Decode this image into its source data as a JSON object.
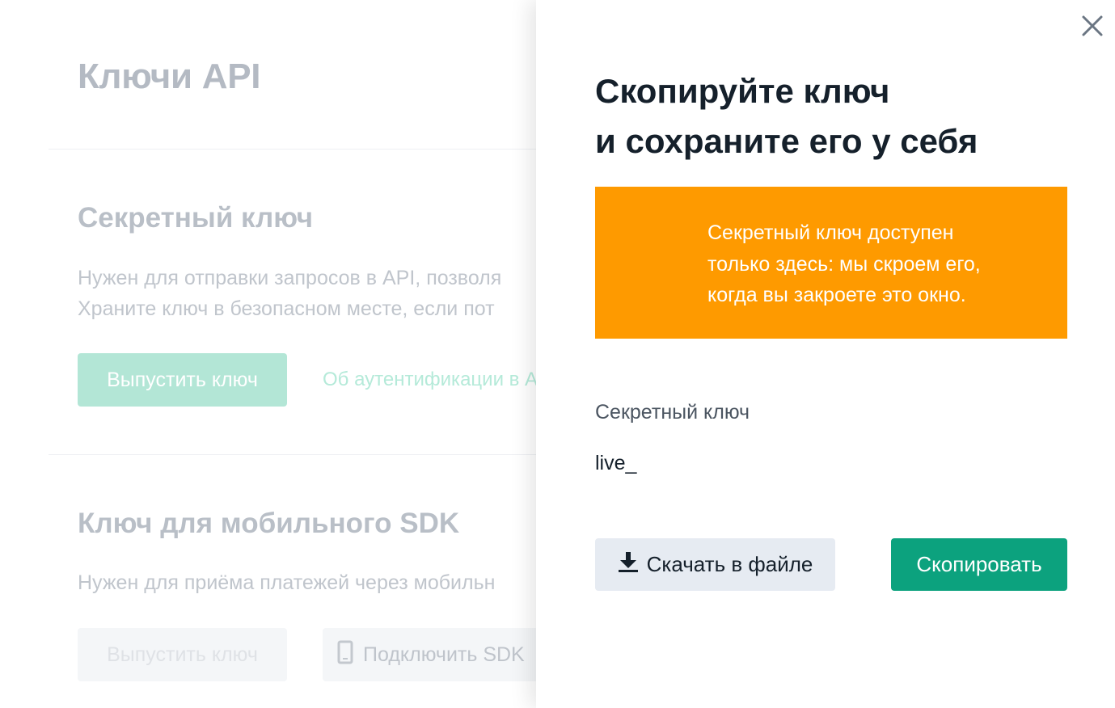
{
  "page": {
    "title": "Ключи API",
    "secret_section": {
      "heading": "Секретный ключ",
      "desc_line1": "Нужен для отправки запросов в API, позволя",
      "desc_line2": "Храните ключ в безопасном месте, если пот",
      "issue_button": "Выпустить ключ",
      "auth_link": "Об аутентификации в А"
    },
    "sdk_section": {
      "heading": "Ключ для мобильного SDK",
      "desc": "Нужен для приёма платежей через мобильн",
      "issue_button": "Выпустить ключ",
      "connect_button": "Подключить SDK"
    }
  },
  "modal": {
    "title_line1": "Скопируйте ключ",
    "title_line2": "и сохраните его у себя",
    "warning": {
      "line1": "Секретный ключ доступен",
      "line2": "только здесь: мы скроем его,",
      "line3": "когда вы закроете это окно."
    },
    "key_label": "Секретный ключ",
    "key_value_visible": "live_",
    "download_button": "Скачать в файле",
    "copy_button": "Скопировать",
    "icons": {
      "close": "close-icon",
      "download": "download-icon",
      "phone": "phone-icon"
    },
    "colors": {
      "warning_bg": "#fe9a00",
      "primary": "#0ca27e",
      "secondary_bg": "#e6ebf2"
    }
  }
}
